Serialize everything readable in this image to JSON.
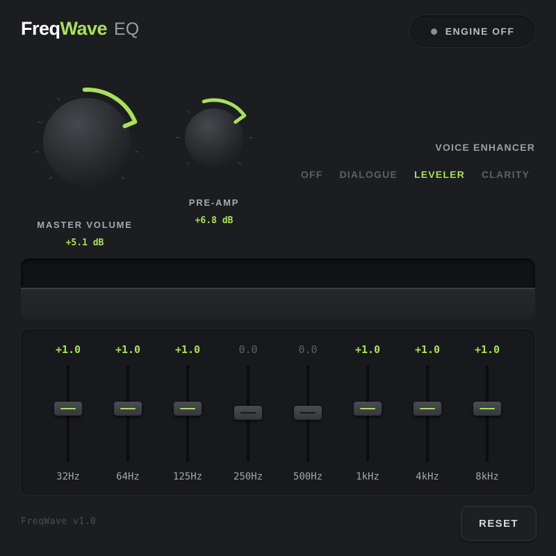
{
  "header": {
    "brand_part1": "Freq",
    "brand_part2": "Wave",
    "brand_suffix": "EQ",
    "engine_button_label": "ENGINE OFF",
    "engine_state": "off"
  },
  "knobs": {
    "master": {
      "label": "MASTER VOLUME",
      "value": "+5.1 dB",
      "level": 0.75
    },
    "preamp": {
      "label": "PRE-AMP",
      "value": "+6.8 dB",
      "level": 0.7
    }
  },
  "voice_enhancer": {
    "title": "VOICE ENHANCER",
    "options": [
      "OFF",
      "DIALOGUE",
      "LEVELER",
      "CLARITY"
    ],
    "selected": "LEVELER"
  },
  "eq": {
    "bands": [
      {
        "freq": "32Hz",
        "value_label": "+1.0",
        "gain": 1.0
      },
      {
        "freq": "64Hz",
        "value_label": "+1.0",
        "gain": 1.0
      },
      {
        "freq": "125Hz",
        "value_label": "+1.0",
        "gain": 1.0
      },
      {
        "freq": "250Hz",
        "value_label": "0.0",
        "gain": 0.0
      },
      {
        "freq": "500Hz",
        "value_label": "0.0",
        "gain": 0.0
      },
      {
        "freq": "1kHz",
        "value_label": "+1.0",
        "gain": 1.0
      },
      {
        "freq": "4kHz",
        "value_label": "+1.0",
        "gain": 1.0
      },
      {
        "freq": "8kHz",
        "value_label": "+1.0",
        "gain": 1.0
      }
    ]
  },
  "footer": {
    "version": "FreqWave v1.0",
    "reset_label": "RESET"
  },
  "colors": {
    "accent": "#a8e05c",
    "background": "#1c1d20",
    "muted": "#5d6066"
  }
}
